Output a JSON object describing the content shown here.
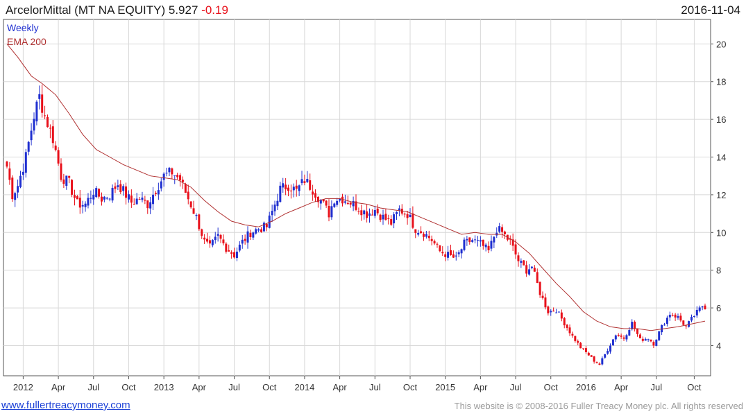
{
  "header": {
    "title": "ArcelorMittal (MT NA EQUITY) 5.927",
    "change": "-0.19",
    "date": "2016-11-04"
  },
  "footer": {
    "link": "www.fullertreacymoney.com",
    "copyright": "This website is © 2008-2016 Fuller Treacy Money plc. All rights reserved"
  },
  "colors": {
    "up": "#1f2fd0",
    "down": "#e8101a",
    "ema": "#b03030",
    "grid": "#d8d8d8"
  },
  "chart_data": {
    "type": "candlestick",
    "frequency": "Weekly",
    "legend": [
      "Weekly",
      "EMA 200"
    ],
    "legend_placement": "top-left",
    "grid": true,
    "y_axis_side": "right",
    "ylim": [
      2.4,
      21.3
    ],
    "yticks": [
      4,
      6,
      8,
      10,
      12,
      14,
      16,
      18,
      20
    ],
    "x_start": "2011-11-25",
    "x_end": "2016-11-04",
    "xticks": [
      {
        "label": "2012",
        "date": "2012-01-06"
      },
      {
        "label": "Apr",
        "date": "2012-04-06"
      },
      {
        "label": "Jul",
        "date": "2012-07-06"
      },
      {
        "label": "Oct",
        "date": "2012-10-05"
      },
      {
        "label": "2013",
        "date": "2013-01-04"
      },
      {
        "label": "Apr",
        "date": "2013-04-05"
      },
      {
        "label": "Jul",
        "date": "2013-07-05"
      },
      {
        "label": "Oct",
        "date": "2013-10-04"
      },
      {
        "label": "2014",
        "date": "2014-01-03"
      },
      {
        "label": "Apr",
        "date": "2014-04-04"
      },
      {
        "label": "Jul",
        "date": "2014-07-04"
      },
      {
        "label": "Oct",
        "date": "2014-10-03"
      },
      {
        "label": "2015",
        "date": "2015-01-02"
      },
      {
        "label": "Apr",
        "date": "2015-04-03"
      },
      {
        "label": "Jul",
        "date": "2015-07-03"
      },
      {
        "label": "Oct",
        "date": "2015-10-02"
      },
      {
        "label": "2016",
        "date": "2016-01-01"
      },
      {
        "label": "Apr",
        "date": "2016-04-01"
      },
      {
        "label": "Jul",
        "date": "2016-07-01"
      },
      {
        "label": "Oct",
        "date": "2016-10-07"
      }
    ],
    "close_anchors": [
      [
        "2011-11-25",
        13.5
      ],
      [
        "2011-12-09",
        12.0
      ],
      [
        "2011-12-23",
        12.5
      ],
      [
        "2012-01-13",
        14.0
      ],
      [
        "2012-02-03",
        16.2
      ],
      [
        "2012-02-17",
        17.2
      ],
      [
        "2012-03-02",
        16.2
      ],
      [
        "2012-03-23",
        15.0
      ],
      [
        "2012-04-13",
        13.0
      ],
      [
        "2012-05-04",
        12.6
      ],
      [
        "2012-05-25",
        11.5
      ],
      [
        "2012-06-15",
        11.5
      ],
      [
        "2012-07-06",
        12.2
      ],
      [
        "2012-07-27",
        11.8
      ],
      [
        "2012-08-17",
        12.0
      ],
      [
        "2012-09-07",
        12.6
      ],
      [
        "2012-09-28",
        12.0
      ],
      [
        "2012-10-12",
        11.6
      ],
      [
        "2012-11-02",
        11.8
      ],
      [
        "2012-11-23",
        11.5
      ],
      [
        "2012-12-14",
        12.3
      ],
      [
        "2013-01-04",
        13.0
      ],
      [
        "2013-01-25",
        13.2
      ],
      [
        "2013-02-15",
        12.8
      ],
      [
        "2013-03-08",
        11.8
      ],
      [
        "2013-03-29",
        10.8
      ],
      [
        "2013-04-19",
        9.5
      ],
      [
        "2013-05-03",
        9.2
      ],
      [
        "2013-05-24",
        9.8
      ],
      [
        "2013-06-14",
        9.2
      ],
      [
        "2013-07-05",
        8.8
      ],
      [
        "2013-07-26",
        9.5
      ],
      [
        "2013-08-16",
        10.0
      ],
      [
        "2013-09-06",
        10.2
      ],
      [
        "2013-09-27",
        10.3
      ],
      [
        "2013-10-18",
        11.5
      ],
      [
        "2013-11-01",
        12.3
      ],
      [
        "2013-11-22",
        12.5
      ],
      [
        "2013-12-13",
        12.2
      ],
      [
        "2014-01-03",
        12.8
      ],
      [
        "2014-01-24",
        12.3
      ],
      [
        "2014-02-14",
        11.7
      ],
      [
        "2014-03-07",
        11.0
      ],
      [
        "2014-03-21",
        11.8
      ],
      [
        "2014-04-11",
        11.8
      ],
      [
        "2014-05-02",
        11.6
      ],
      [
        "2014-05-23",
        11.3
      ],
      [
        "2014-06-13",
        11.0
      ],
      [
        "2014-07-04",
        11.2
      ],
      [
        "2014-07-25",
        10.8
      ],
      [
        "2014-08-15",
        10.5
      ],
      [
        "2014-09-05",
        11.2
      ],
      [
        "2014-09-26",
        11.0
      ],
      [
        "2014-10-17",
        10.2
      ],
      [
        "2014-11-07",
        10.0
      ],
      [
        "2014-11-28",
        9.6
      ],
      [
        "2014-12-19",
        9.0
      ],
      [
        "2015-01-09",
        8.8
      ],
      [
        "2015-01-30",
        8.6
      ],
      [
        "2015-02-20",
        9.4
      ],
      [
        "2015-03-13",
        9.6
      ],
      [
        "2015-04-03",
        9.4
      ],
      [
        "2015-04-24",
        9.0
      ],
      [
        "2015-05-15",
        10.2
      ],
      [
        "2015-05-29",
        10.0
      ],
      [
        "2015-06-19",
        9.5
      ],
      [
        "2015-07-10",
        8.5
      ],
      [
        "2015-07-31",
        8.0
      ],
      [
        "2015-08-14",
        8.2
      ],
      [
        "2015-09-04",
        6.8
      ],
      [
        "2015-09-25",
        5.8
      ],
      [
        "2015-10-16",
        5.9
      ],
      [
        "2015-11-06",
        5.2
      ],
      [
        "2015-11-27",
        4.5
      ],
      [
        "2015-12-18",
        3.9
      ],
      [
        "2016-01-08",
        3.5
      ],
      [
        "2016-01-22",
        3.2
      ],
      [
        "2016-02-05",
        3.0
      ],
      [
        "2016-02-26",
        3.8
      ],
      [
        "2016-03-18",
        4.6
      ],
      [
        "2016-04-08",
        4.4
      ],
      [
        "2016-04-29",
        5.2
      ],
      [
        "2016-05-20",
        4.3
      ],
      [
        "2016-06-10",
        4.4
      ],
      [
        "2016-06-24",
        4.1
      ],
      [
        "2016-07-15",
        5.0
      ],
      [
        "2016-08-05",
        5.7
      ],
      [
        "2016-08-26",
        5.5
      ],
      [
        "2016-09-16",
        5.0
      ],
      [
        "2016-10-07",
        5.6
      ],
      [
        "2016-10-28",
        6.1
      ],
      [
        "2016-11-04",
        5.93
      ]
    ],
    "ema_200": [
      [
        "2011-11-25",
        20.0
      ],
      [
        "2011-12-23",
        19.3
      ],
      [
        "2012-01-27",
        18.3
      ],
      [
        "2012-02-24",
        17.9
      ],
      [
        "2012-03-30",
        17.3
      ],
      [
        "2012-05-04",
        16.3
      ],
      [
        "2012-06-08",
        15.2
      ],
      [
        "2012-07-13",
        14.4
      ],
      [
        "2012-08-17",
        14.0
      ],
      [
        "2012-09-21",
        13.6
      ],
      [
        "2012-10-26",
        13.3
      ],
      [
        "2012-11-30",
        13.0
      ],
      [
        "2013-01-04",
        12.9
      ],
      [
        "2013-02-08",
        12.8
      ],
      [
        "2013-03-15",
        12.4
      ],
      [
        "2013-04-19",
        11.7
      ],
      [
        "2013-05-24",
        11.1
      ],
      [
        "2013-06-28",
        10.6
      ],
      [
        "2013-08-02",
        10.4
      ],
      [
        "2013-09-06",
        10.3
      ],
      [
        "2013-10-11",
        10.6
      ],
      [
        "2013-11-15",
        11.0
      ],
      [
        "2013-12-20",
        11.3
      ],
      [
        "2014-01-24",
        11.6
      ],
      [
        "2014-02-28",
        11.8
      ],
      [
        "2014-04-04",
        11.8
      ],
      [
        "2014-05-09",
        11.6
      ],
      [
        "2014-06-13",
        11.5
      ],
      [
        "2014-07-18",
        11.3
      ],
      [
        "2014-08-22",
        11.2
      ],
      [
        "2014-09-26",
        11.1
      ],
      [
        "2014-10-31",
        10.8
      ],
      [
        "2014-12-05",
        10.5
      ],
      [
        "2015-01-09",
        10.2
      ],
      [
        "2015-02-13",
        9.9
      ],
      [
        "2015-03-20",
        10.0
      ],
      [
        "2015-04-24",
        9.9
      ],
      [
        "2015-05-29",
        9.9
      ],
      [
        "2015-07-03",
        9.5
      ],
      [
        "2015-08-07",
        8.9
      ],
      [
        "2015-09-11",
        8.1
      ],
      [
        "2015-10-16",
        7.3
      ],
      [
        "2015-11-20",
        6.6
      ],
      [
        "2015-12-25",
        5.8
      ],
      [
        "2016-01-29",
        5.3
      ],
      [
        "2016-03-04",
        5.0
      ],
      [
        "2016-04-08",
        4.9
      ],
      [
        "2016-05-13",
        4.9
      ],
      [
        "2016-06-17",
        4.8
      ],
      [
        "2016-07-22",
        4.9
      ],
      [
        "2016-08-26",
        5.0
      ],
      [
        "2016-09-30",
        5.15
      ],
      [
        "2016-11-04",
        5.3
      ]
    ]
  }
}
